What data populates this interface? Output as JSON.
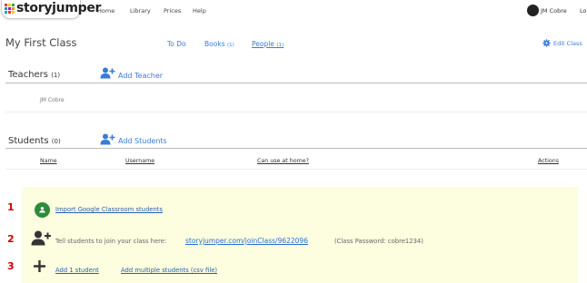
{
  "header": {
    "logo_text": "storyjumper",
    "nav": [
      "Home",
      "Library",
      "Prices",
      "Help"
    ],
    "user_name": "JM Cobre",
    "logout_truncated": "Lo"
  },
  "class_bar": {
    "title": "My First Class",
    "tabs": [
      {
        "label": "To Do",
        "count": ""
      },
      {
        "label": "Books",
        "count": "(1)"
      },
      {
        "label": "People",
        "count": "(1)"
      }
    ],
    "edit_label": "Edit Class"
  },
  "teachers": {
    "title": "Teachers",
    "count": "(1)",
    "add_label": "Add Teacher",
    "list": [
      "JM Cobre"
    ]
  },
  "students": {
    "title": "Students",
    "count": "(0)",
    "add_label": "Add Students",
    "columns": [
      "Name",
      "Username",
      "Can use at home?",
      "Actions"
    ]
  },
  "options": {
    "step1_num": "1",
    "step1_link": "Import Google Classroom students",
    "step2_num": "2",
    "step2_text": "Tell students to join your class here:",
    "step2_url": "storyjumper.com/joinClass/9622096",
    "step2_password": "(Class Password: cobre1234)",
    "step3_num": "3",
    "step3_link1": "Add 1 student",
    "step3_link2": "Add multiple students (csv file)"
  },
  "colors": {
    "accent": "#3a7bd5",
    "number_red": "#d10000",
    "panel_yellow": "#fdfde0",
    "google_green": "#2e8b3a"
  }
}
